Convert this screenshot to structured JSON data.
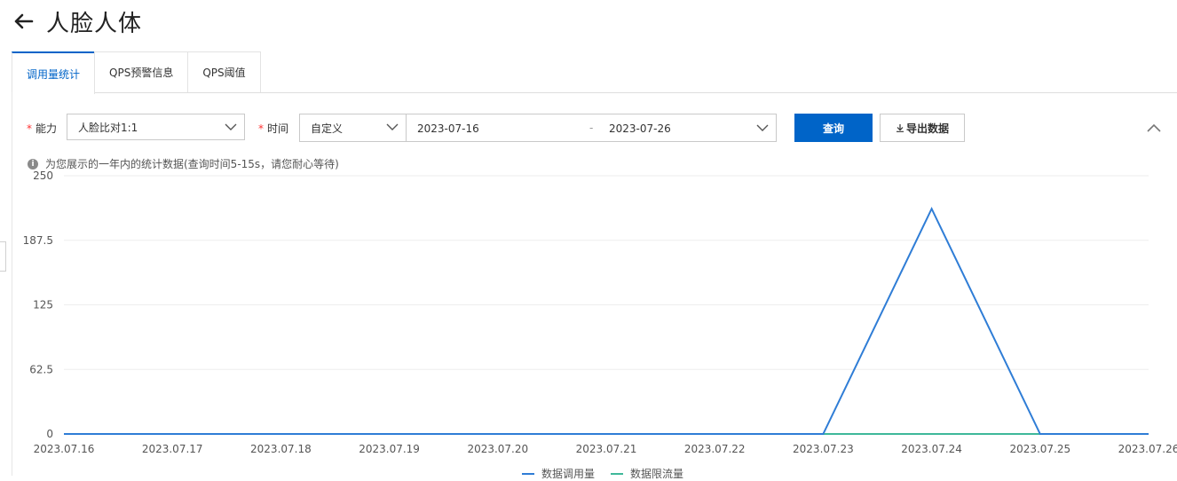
{
  "page": {
    "title": "人脸人体"
  },
  "tabs": [
    {
      "label": "调用量统计",
      "active": true
    },
    {
      "label": "QPS预警信息",
      "active": false
    },
    {
      "label": "QPS阈值",
      "active": false
    }
  ],
  "filters": {
    "ability_label": "能力",
    "ability_value": "人脸比对1:1",
    "time_label": "时间",
    "time_mode_value": "自定义",
    "date_start": "2023-07-16",
    "date_separator": "-",
    "date_end": "2023-07-26",
    "query_button": "查询",
    "export_button": "导出数据"
  },
  "notice": "为您展示的一年内的统计数据(查询时间5-15s，请您耐心等待)",
  "colors": {
    "accent": "#0064c8",
    "series_call": "#2f7dd6",
    "series_throttle": "#3fb89a"
  },
  "chart_data": {
    "type": "line",
    "categories": [
      "2023.07.16",
      "2023.07.17",
      "2023.07.18",
      "2023.07.19",
      "2023.07.20",
      "2023.07.21",
      "2023.07.22",
      "2023.07.23",
      "2023.07.24",
      "2023.07.25",
      "2023.07.26"
    ],
    "y_ticks": [
      "250",
      "187.5",
      "125",
      "62.5",
      "0"
    ],
    "ylim": [
      0,
      250
    ],
    "series": [
      {
        "name": "数据调用量",
        "color": "#2f7dd6",
        "values": [
          0,
          0,
          0,
          0,
          0,
          0,
          0,
          0,
          218,
          0,
          0
        ]
      },
      {
        "name": "数据限流量",
        "color": "#3fb89a",
        "values": [
          0,
          0,
          0,
          0,
          0,
          0,
          0,
          0,
          0,
          0,
          0
        ]
      }
    ],
    "grid": true,
    "legend_position": "bottom"
  }
}
